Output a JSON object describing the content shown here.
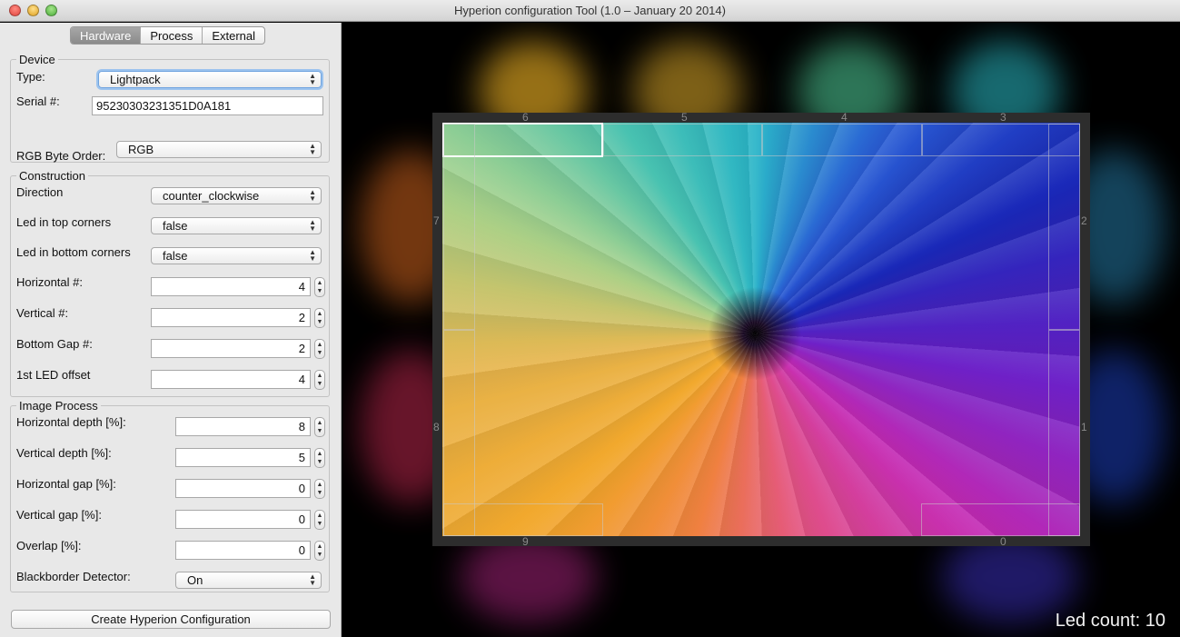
{
  "window": {
    "title": "Hyperion configuration Tool (1.0 – January 20 2014)"
  },
  "tabs": [
    {
      "label": "Hardware"
    },
    {
      "label": "Process"
    },
    {
      "label": "External"
    }
  ],
  "device": {
    "group_title": "Device",
    "type_label": "Type:",
    "type_value": "Lightpack",
    "serial_label": "Serial #:",
    "serial_value": "95230303231351D0A181",
    "rgb_order_label": "RGB Byte Order:",
    "rgb_order_value": "RGB"
  },
  "construction": {
    "group_title": "Construction",
    "direction_label": "Direction",
    "direction_value": "counter_clockwise",
    "top_corners_label": "Led in top corners",
    "top_corners_value": "false",
    "bottom_corners_label": "Led in bottom corners",
    "bottom_corners_value": "false",
    "horizontal_label": "Horizontal #:",
    "horizontal_value": "4",
    "vertical_label": "Vertical #:",
    "vertical_value": "2",
    "bottom_gap_label": "Bottom Gap #:",
    "bottom_gap_value": "2",
    "led_offset_label": "1st LED offset",
    "led_offset_value": "4"
  },
  "image_process": {
    "group_title": "Image Process",
    "h_depth_label": "Horizontal depth [%]:",
    "h_depth_value": "8",
    "v_depth_label": "Vertical depth [%]:",
    "v_depth_value": "5",
    "h_gap_label": "Horizontal gap [%]:",
    "h_gap_value": "0",
    "v_gap_label": "Vertical gap [%]:",
    "v_gap_value": "0",
    "overlap_label": "Overlap [%]:",
    "overlap_value": "0",
    "blackborder_label": "Blackborder Detector:",
    "blackborder_value": "On"
  },
  "actions": {
    "create_label": "Create Hyperion Configuration"
  },
  "preview": {
    "led_numbers": [
      "0",
      "1",
      "2",
      "3",
      "4",
      "5",
      "6",
      "7",
      "8",
      "9"
    ],
    "led_count_label": "Led count: 10"
  },
  "colors": {
    "accent_focus": "#6fa3df",
    "tab_active": "#8b8b8b",
    "monitor_frame": "#2d2d2d"
  }
}
